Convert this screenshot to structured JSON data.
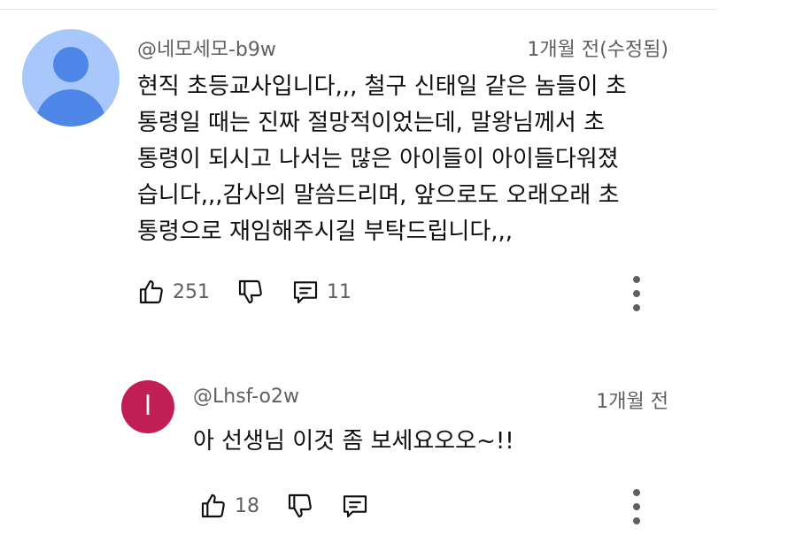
{
  "comment": {
    "author": "@네모세모-b9w",
    "time": "1개월 전(수정됨)",
    "text": "현직 초등교사입니다,,, 철구 신태일 같은 놈들이 초\n통령일 때는 진짜 절망적이었는데, 말왕님께서 초\n통령이 되시고 나서는 많은 아이들이 아이들다워졌\n습니다,,,감사의 말씀드리며, 앞으로도 오래오래 초\n통령으로 재임해주시길 부탁드립니다,,,",
    "likes": "251",
    "replies": "11",
    "icons": {
      "like": "thumbs-up-icon",
      "dislike": "thumbs-down-icon",
      "reply": "reply-icon",
      "more": "more-vert-icon"
    }
  },
  "reply": {
    "avatar_letter": "l",
    "avatar_color": "#c21e56",
    "author": "@Lhsf-o2w",
    "time": "1개월 전",
    "text": "아 선생님 이것 좀 보세요오오~!!",
    "likes": "18"
  }
}
